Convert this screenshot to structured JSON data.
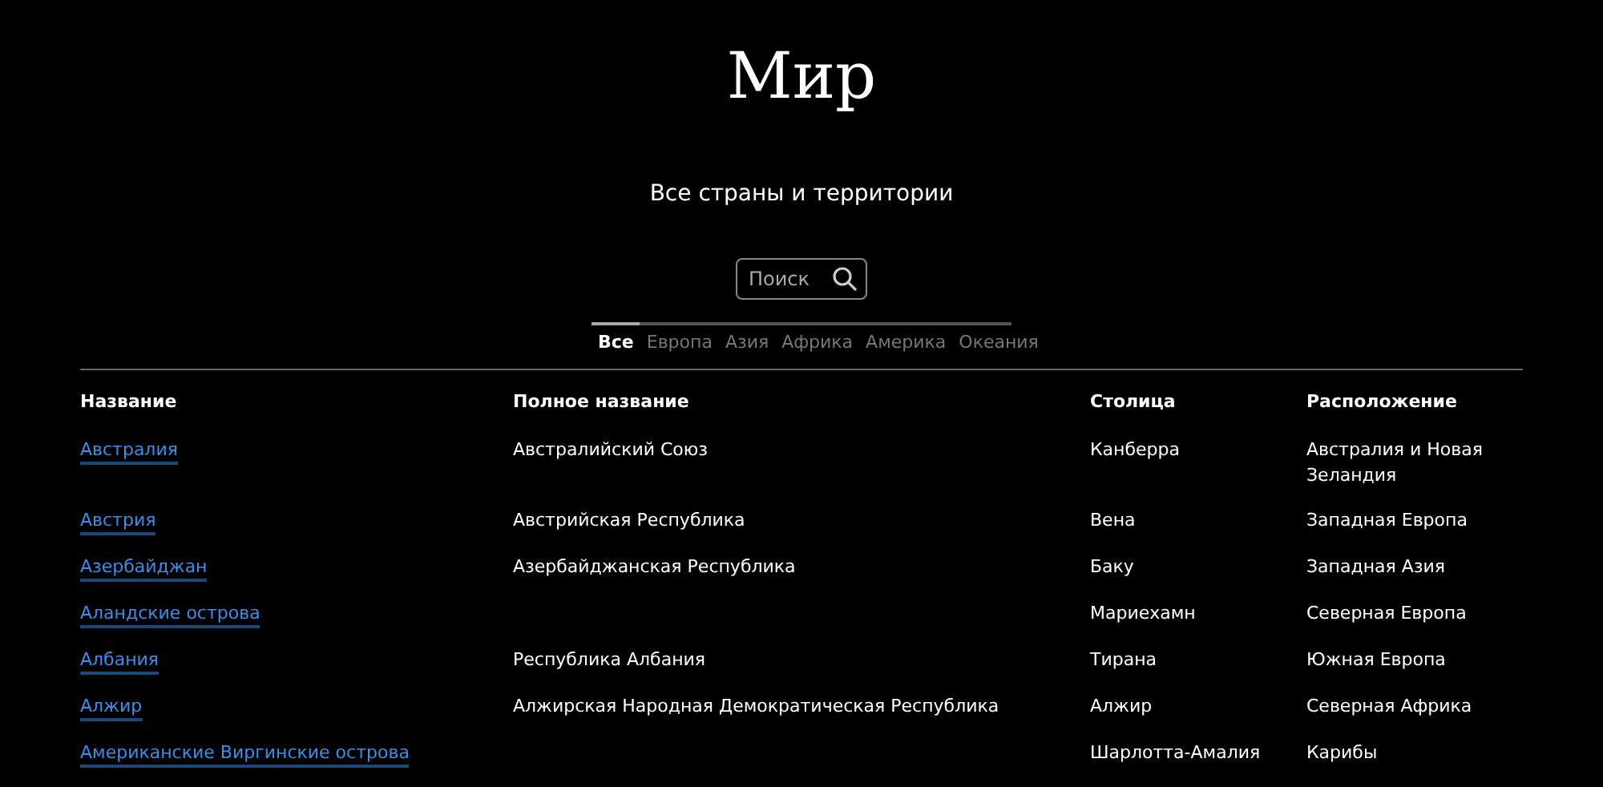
{
  "title": "Мир",
  "subtitle": "Все страны и территории",
  "search": {
    "placeholder": "Поиск"
  },
  "tabs": [
    {
      "label": "Все",
      "selected": true
    },
    {
      "label": "Европа",
      "selected": false
    },
    {
      "label": "Азия",
      "selected": false
    },
    {
      "label": "Африка",
      "selected": false
    },
    {
      "label": "Америка",
      "selected": false
    },
    {
      "label": "Океания",
      "selected": false
    }
  ],
  "table": {
    "columns": [
      "Название",
      "Полное название",
      "Столица",
      "Расположение"
    ],
    "rows": [
      {
        "name": "Австралия",
        "full_name": "Австралийский Союз",
        "capital": "Канберра",
        "location": "Австралия и Новая Зеландия"
      },
      {
        "name": "Австрия",
        "full_name": "Австрийская Республика",
        "capital": "Вена",
        "location": "Западная Европа"
      },
      {
        "name": "Азербайджан",
        "full_name": "Азербайджанская Республика",
        "capital": "Баку",
        "location": "Западная Азия"
      },
      {
        "name": "Аландские острова",
        "capital": "Мариехамн",
        "location": "Северная Европа"
      },
      {
        "name": "Албания",
        "full_name": "Республика Албания",
        "capital": "Тирана",
        "location": "Южная Европа"
      },
      {
        "name": "Алжир",
        "full_name": "Алжирская Народная Демократическая Республика",
        "capital": "Алжир",
        "location": "Северная Африка"
      },
      {
        "name": "Американские Виргинские острова",
        "capital": "Шарлотта-Амалия",
        "location": "Карибы"
      }
    ]
  }
}
